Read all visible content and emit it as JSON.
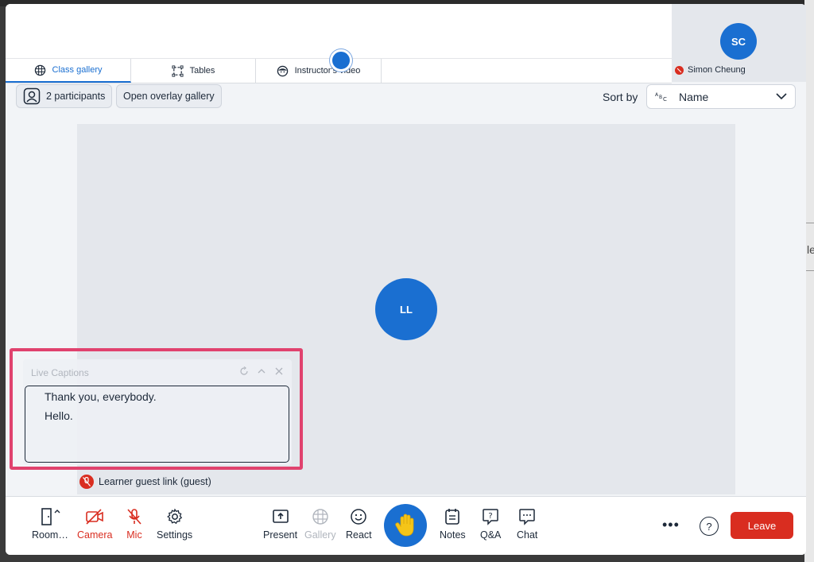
{
  "tabs": [
    {
      "label": "Class gallery",
      "icon": "grid-globe-icon",
      "active": true
    },
    {
      "label": "Tables",
      "icon": "tables-icon",
      "active": false
    },
    {
      "label": "Instructor's video",
      "icon": "instructor-icon",
      "active": false
    }
  ],
  "self_tile": {
    "initials": "SC",
    "name": "Simon Cheung",
    "muted": true
  },
  "controls": {
    "participants_label": "2 participants",
    "overlay_label": "Open overlay gallery",
    "sort_label": "Sort by",
    "sort_value": "Name"
  },
  "participant": {
    "initials": "LL"
  },
  "captions": {
    "title": "Live Captions",
    "lines": [
      "Thank you, everybody.",
      "Hello."
    ]
  },
  "guest": {
    "name": "Learner guest link (guest)",
    "muted": true
  },
  "toolbar": {
    "room": "Room…",
    "camera": "Camera",
    "mic": "Mic",
    "settings": "Settings",
    "present": "Present",
    "gallery": "Gallery",
    "react": "React",
    "notes": "Notes",
    "qa": "Q&A",
    "chat": "Chat",
    "more": "•••",
    "help": "?",
    "leave": "Leave"
  },
  "colors": {
    "accent": "#1a6fd1",
    "danger": "#d92d20",
    "highlight": "#e0426e"
  }
}
